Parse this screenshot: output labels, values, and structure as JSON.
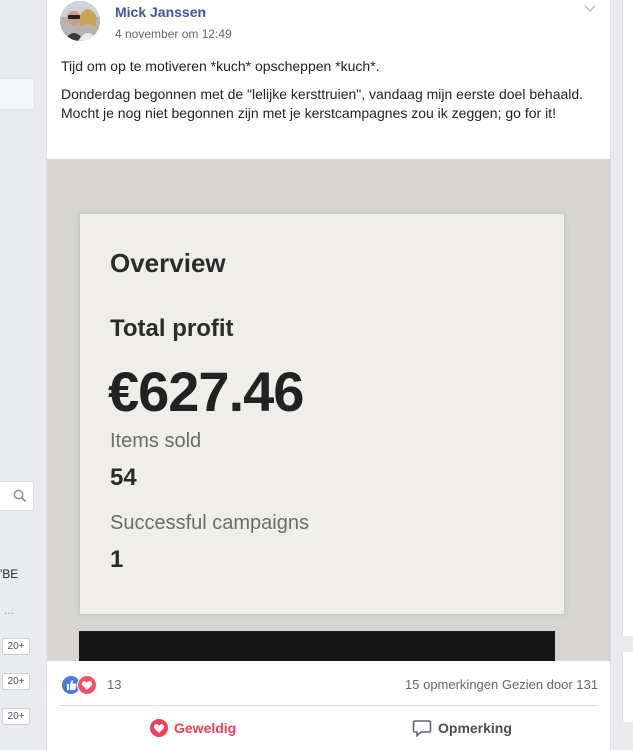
{
  "post": {
    "author": "Mick Janssen",
    "timestamp": "4 november om 12:49",
    "message_line1": "Tijd om op te motiveren *kuch* opscheppen *kuch*.",
    "message_line2": "Donderdag begonnen met de \"lelijke kersttruien\", vandaag mijn eerste doel behaald. Mocht je nog niet begonnen zijn met je kerstcampagnes zou ik zeggen; go for it!"
  },
  "photo": {
    "overview_heading": "Overview",
    "total_profit_label": "Total profit",
    "total_profit_value": "€627.46",
    "items_sold_label": "Items sold",
    "items_sold_value": "54",
    "campaigns_label": "Successful campaigns",
    "campaigns_value": "1"
  },
  "engagement": {
    "reaction_count": "13",
    "comments": "15 opmerkingen",
    "views": "Gezien door 131",
    "love_button": "Geweldig",
    "comment_button": "Opmerking"
  },
  "sidebar": {
    "text_be": "'BE",
    "dots": "...",
    "badges": [
      "20+",
      "20+",
      "20+"
    ]
  },
  "colors": {
    "author_link": "#385898",
    "love": "#f33e58",
    "like": "#4a7bd9",
    "background": "#e9ebee"
  }
}
